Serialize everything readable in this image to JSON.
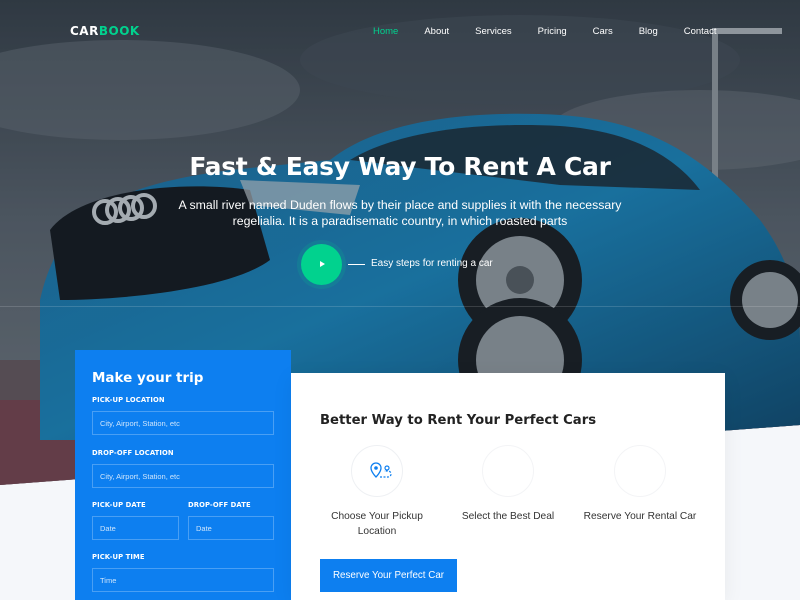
{
  "brand": {
    "part1": "CAR",
    "part2": "BOOK"
  },
  "nav": [
    {
      "label": "Home",
      "active": true
    },
    {
      "label": "About"
    },
    {
      "label": "Services"
    },
    {
      "label": "Pricing"
    },
    {
      "label": "Cars"
    },
    {
      "label": "Blog"
    },
    {
      "label": "Contact"
    }
  ],
  "hero": {
    "title": "Fast & Easy Way To Rent A Car",
    "text": "A small river named Duden flows by their place and supplies it with the necessary regelialia. It is a paradisematic country, in which roasted parts",
    "play_icon": "play-icon",
    "steps_link": "Easy steps for renting a car"
  },
  "trip_form": {
    "title": "Make your trip",
    "pickup_location_label": "PICK-UP LOCATION",
    "pickup_location_placeholder": "City, Airport, Station, etc",
    "dropoff_location_label": "DROP-OFF LOCATION",
    "dropoff_location_placeholder": "City, Airport, Station, etc",
    "pickup_date_label": "PICK-UP DATE",
    "pickup_date_placeholder": "Date",
    "dropoff_date_label": "DROP-OFF DATE",
    "dropoff_date_placeholder": "Date",
    "pickup_time_label": "PICK-UP TIME",
    "pickup_time_placeholder": "Time"
  },
  "info": {
    "title": "Better Way to Rent Your Perfect Cars",
    "steps": [
      {
        "label": "Choose Your Pickup Location",
        "icon": "route-pin-icon"
      },
      {
        "label": "Select the Best Deal",
        "icon": "deal-icon"
      },
      {
        "label": "Reserve Your Rental Car",
        "icon": "car-icon"
      }
    ],
    "button_label": "Reserve Your Perfect Car"
  },
  "colors": {
    "accent_green": "#01d28e",
    "primary_blue": "#0d7ff0"
  }
}
